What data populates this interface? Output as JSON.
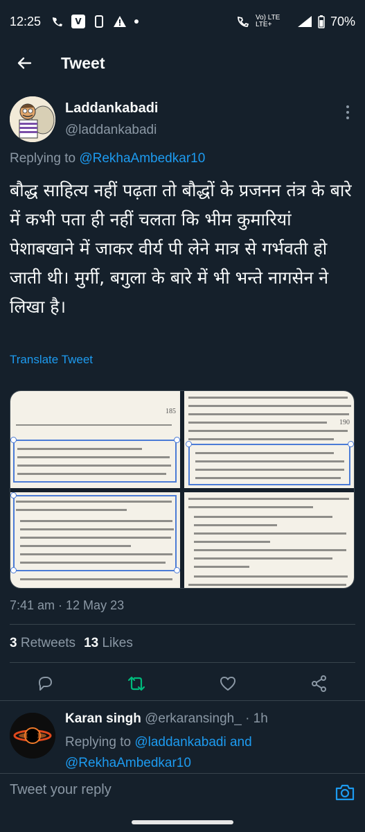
{
  "status_bar": {
    "time": "12:25",
    "network": "Vo) LTE LTE+",
    "battery": "70%"
  },
  "app_bar": {
    "title": "Tweet",
    "back_icon": "arrow-left-icon"
  },
  "tweet": {
    "author_name": "Laddankabadi",
    "author_handle": "@laddankabadi",
    "replying_prefix": "Replying to",
    "replying_to": "@RekhaAmbedkar10",
    "text": "बौद्ध साहित्य नहीं पढ़ता तो बौद्धों के प्रजनन तंत्र के बारे में कभी पता ही नहीं चलता कि भीम कुमारियां पेशाबखाने में जाकर वीर्य पी लेने मात्र से गर्भवती हो जाती थी। मुर्गी, बगुला के बारे में भी भन्ते नागसेन ने लिखा है।",
    "translate_label": "Translate Tweet",
    "timestamp": "7:41 am · 12 May 23",
    "media_page_numbers": [
      "185",
      "190"
    ],
    "retweets_count": "3",
    "retweets_label": "Retweets",
    "likes_count": "13",
    "likes_label": "Likes"
  },
  "reply": {
    "author_name": "Karan singh",
    "author_handle": "@erkaransingh_ · 1h",
    "replying_prefix": "Replying to",
    "mention_1": "@laddankabadi",
    "and_label": "and",
    "mention_2": "@RekhaAmbedkar10"
  },
  "compose": {
    "placeholder": "Tweet your reply"
  },
  "colors": {
    "background": "#15202b",
    "accent": "#1d9bf0",
    "retweet_green": "#00ba7c",
    "secondary_text": "#8b98a5"
  }
}
